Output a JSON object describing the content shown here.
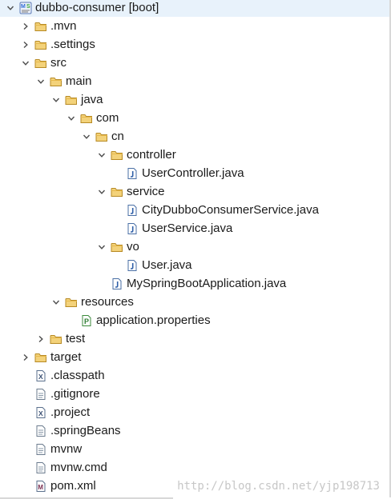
{
  "tree": [
    {
      "label": "dubbo-consumer [boot]",
      "depth": 0,
      "expander": "expanded",
      "icon": "maven-project-icon",
      "name": "tree-item-dubbo-consumer"
    },
    {
      "label": ".mvn",
      "depth": 1,
      "expander": "collapsed",
      "icon": "folder-icon",
      "name": "tree-item-mvn"
    },
    {
      "label": ".settings",
      "depth": 1,
      "expander": "collapsed",
      "icon": "folder-icon",
      "name": "tree-item-settings"
    },
    {
      "label": "src",
      "depth": 1,
      "expander": "expanded",
      "icon": "folder-icon",
      "name": "tree-item-src"
    },
    {
      "label": "main",
      "depth": 2,
      "expander": "expanded",
      "icon": "folder-icon",
      "name": "tree-item-main"
    },
    {
      "label": "java",
      "depth": 3,
      "expander": "expanded",
      "icon": "folder-icon",
      "name": "tree-item-java"
    },
    {
      "label": "com",
      "depth": 4,
      "expander": "expanded",
      "icon": "folder-icon",
      "name": "tree-item-com"
    },
    {
      "label": "cn",
      "depth": 5,
      "expander": "expanded",
      "icon": "folder-icon",
      "name": "tree-item-cn"
    },
    {
      "label": "controller",
      "depth": 6,
      "expander": "expanded",
      "icon": "folder-icon",
      "name": "tree-item-controller"
    },
    {
      "label": "UserController.java",
      "depth": 7,
      "expander": "none",
      "icon": "java-file-icon",
      "name": "tree-item-usercontroller-java"
    },
    {
      "label": "service",
      "depth": 6,
      "expander": "expanded",
      "icon": "folder-icon",
      "name": "tree-item-service"
    },
    {
      "label": "CityDubboConsumerService.java",
      "depth": 7,
      "expander": "none",
      "icon": "java-file-icon",
      "name": "tree-item-citydubboconsumerservice-java"
    },
    {
      "label": "UserService.java",
      "depth": 7,
      "expander": "none",
      "icon": "java-file-icon",
      "name": "tree-item-userservice-java"
    },
    {
      "label": "vo",
      "depth": 6,
      "expander": "expanded",
      "icon": "folder-icon",
      "name": "tree-item-vo"
    },
    {
      "label": "User.java",
      "depth": 7,
      "expander": "none",
      "icon": "java-file-icon",
      "name": "tree-item-user-java"
    },
    {
      "label": "MySpringBootApplication.java",
      "depth": 6,
      "expander": "none",
      "icon": "java-file-icon",
      "name": "tree-item-myspringbootapplication-java"
    },
    {
      "label": "resources",
      "depth": 3,
      "expander": "expanded",
      "icon": "folder-icon",
      "name": "tree-item-resources"
    },
    {
      "label": "application.properties",
      "depth": 4,
      "expander": "none",
      "icon": "properties-file-icon",
      "name": "tree-item-application-properties"
    },
    {
      "label": "test",
      "depth": 2,
      "expander": "collapsed",
      "icon": "folder-icon",
      "name": "tree-item-test"
    },
    {
      "label": "target",
      "depth": 1,
      "expander": "collapsed",
      "icon": "folder-icon",
      "name": "tree-item-target"
    },
    {
      "label": ".classpath",
      "depth": 1,
      "expander": "none",
      "icon": "xml-file-icon",
      "name": "tree-item-classpath"
    },
    {
      "label": ".gitignore",
      "depth": 1,
      "expander": "none",
      "icon": "text-file-icon",
      "name": "tree-item-gitignore"
    },
    {
      "label": ".project",
      "depth": 1,
      "expander": "none",
      "icon": "xml-file-icon",
      "name": "tree-item-project"
    },
    {
      "label": ".springBeans",
      "depth": 1,
      "expander": "none",
      "icon": "text-file-icon",
      "name": "tree-item-springbeans"
    },
    {
      "label": "mvnw",
      "depth": 1,
      "expander": "none",
      "icon": "text-file-icon",
      "name": "tree-item-mvnw"
    },
    {
      "label": "mvnw.cmd",
      "depth": 1,
      "expander": "none",
      "icon": "text-file-icon",
      "name": "tree-item-mvnw-cmd"
    },
    {
      "label": "pom.xml",
      "depth": 1,
      "expander": "none",
      "icon": "maven-pom-icon",
      "name": "tree-item-pom-xml"
    }
  ],
  "watermark": "http://blog.csdn.net/yjp198713"
}
